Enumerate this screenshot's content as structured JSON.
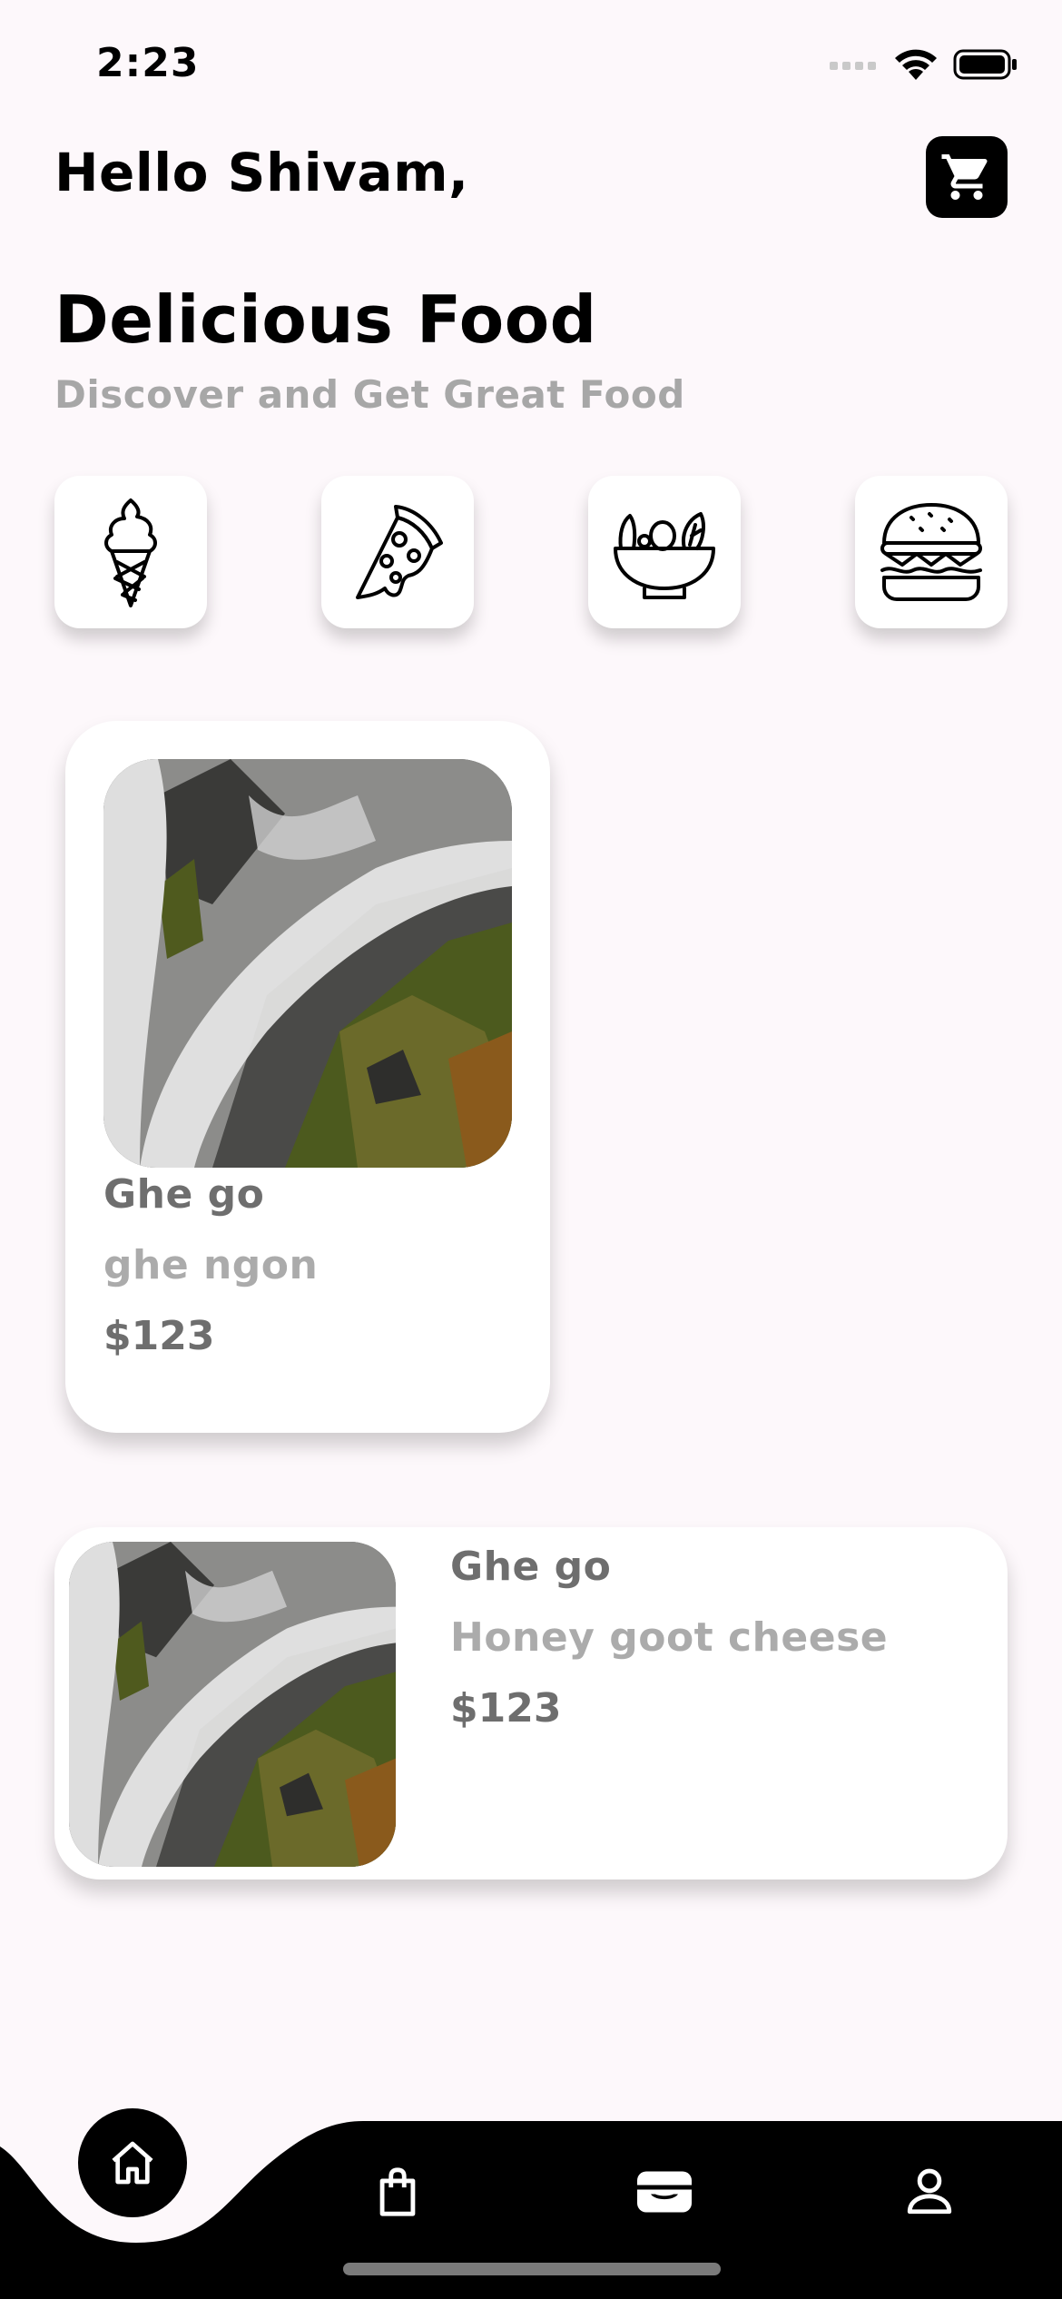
{
  "status_bar": {
    "time": "2:23"
  },
  "header": {
    "greeting": "Hello Shivam,"
  },
  "hero": {
    "title": "Delicious Food",
    "subtitle": "Discover and Get Great Food"
  },
  "categories": [
    {
      "icon": "ice-cream-icon"
    },
    {
      "icon": "pizza-icon"
    },
    {
      "icon": "salad-bowl-icon"
    },
    {
      "icon": "burger-icon"
    }
  ],
  "food_items": [
    {
      "name": "Ghe go",
      "description": "ghe ngon",
      "price": "$123"
    },
    {
      "name": "Ghe go",
      "description": "Honey goot cheese",
      "price": "$123"
    }
  ],
  "bottom_nav": {
    "items": [
      {
        "icon": "home-icon",
        "active": true
      },
      {
        "icon": "shopping-bag-icon",
        "active": false
      },
      {
        "icon": "wallet-icon",
        "active": false
      },
      {
        "icon": "profile-icon",
        "active": false
      }
    ]
  },
  "colors": {
    "accent": "#000000",
    "background": "#fdf8fb",
    "muted_text": "#ababab",
    "card_text": "#6e6e6e"
  }
}
